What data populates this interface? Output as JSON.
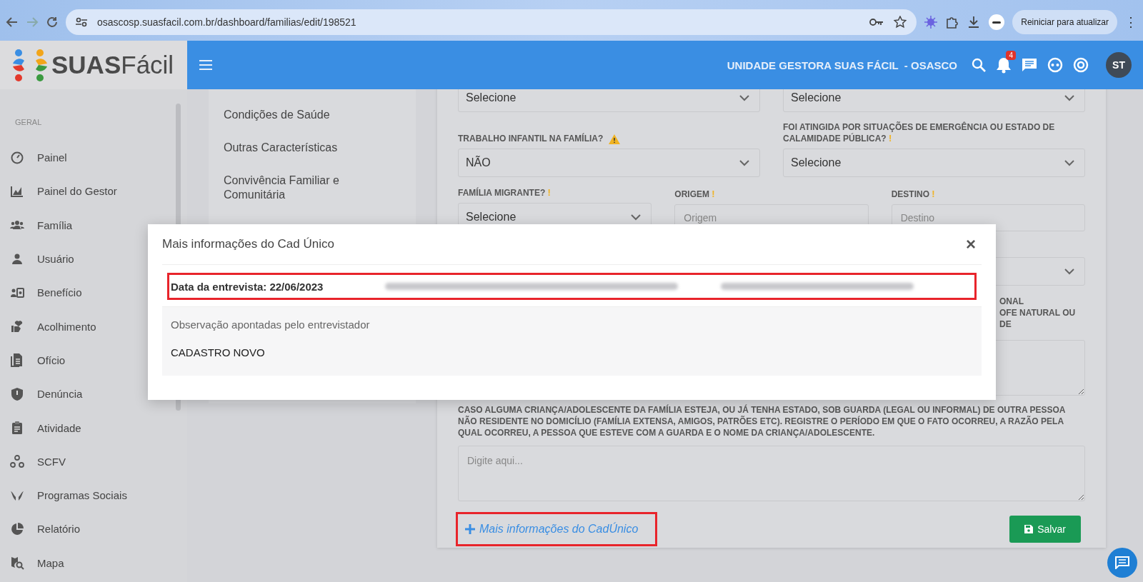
{
  "browser": {
    "url": "osascosp.suasfacil.com.br/dashboard/familias/edit/198521",
    "update_button": "Reiniciar para atualizar",
    "menu": "⋮"
  },
  "header": {
    "logo_bold": "SUAS",
    "logo_light": "Fácil",
    "unit": "UNIDADE GESTORA SUAS FÁCIL  - OSASCO",
    "notifications": "4",
    "avatar": "ST"
  },
  "sidebar": {
    "section": "GERAL",
    "items": [
      {
        "label": "Painel",
        "kind": "gauge"
      },
      {
        "label": "Painel do Gestor",
        "kind": "chart"
      },
      {
        "label": "Família",
        "kind": "group"
      },
      {
        "label": "Usuário",
        "kind": "person"
      },
      {
        "label": "Benefício",
        "kind": "card"
      },
      {
        "label": "Acolhimento",
        "kind": "heart"
      },
      {
        "label": "Ofício",
        "kind": "document"
      },
      {
        "label": "Denúncia",
        "kind": "shield"
      },
      {
        "label": "Atividade",
        "kind": "clipboard"
      },
      {
        "label": "SCFV",
        "kind": "nodes"
      },
      {
        "label": "Programas Sociais",
        "kind": "hands"
      },
      {
        "label": "Relatório",
        "kind": "pie"
      },
      {
        "label": "Mapa",
        "kind": "map"
      }
    ]
  },
  "form_nav": {
    "items": [
      {
        "label": "Condições de Saúde"
      },
      {
        "label": "Outras Características"
      },
      {
        "label": "Convivência Familiar e Comunitária"
      }
    ]
  },
  "form": {
    "rows": [
      [
        {
          "kind": "select",
          "value": "Selecione"
        },
        {
          "kind": "select",
          "value": "Selecione"
        }
      ],
      [
        {
          "kind": "select",
          "label": "TRABALHO INFANTIL NA FAMÍLIA?",
          "warning": true,
          "value": "NÃO"
        },
        {
          "kind": "select",
          "label": "FOI ATINGIDA POR SITUAÇÕES DE EMERGÊNCIA OU ESTADO DE CALAMIDADE PÚBLICA?",
          "mark": "!",
          "value": "Selecione"
        }
      ],
      [
        {
          "kind": "select",
          "label": "FAMÍLIA MIGRANTE?",
          "mark": "!",
          "value": "Selecione"
        },
        {
          "kind": "input",
          "label": "ORIGEM",
          "mark": "!",
          "placeholder": "Origem"
        },
        {
          "kind": "input",
          "label": "DESTINO",
          "mark": "!",
          "placeholder": "Destino"
        }
      ]
    ],
    "partial_label": [
      "ONAL",
      "OFE NATURAL OU DE"
    ],
    "note_label": "CASO ALGUMA CRIANÇA/ADOLESCENTE DA FAMÍLIA ESTEJA, OU JÁ TENHA ESTADO, SOB GUARDA (LEGAL OU INFORMAL) DE OUTRA PESSOA NÃO RESIDENTE NO DOMICÍLIO (FAMÍLIA EXTENSA, AMIGOS, PATRÕES ETC). REGISTRE O PERÍODO EM QUE O FATO OCORREU, A RAZÃO PELA QUAL OCORREU, A PESSOA QUE ESTEVE COM A GUARDA E O NOME DA CRIANÇA/ADOLESCENTE.",
    "note_placeholder": "Digite aqui...",
    "cad_link": {
      "label": "Mais informações do CadÚnico",
      "highlighted": true
    },
    "save_button": "Salvar"
  },
  "modal": {
    "title": "Mais informações do Cad Único",
    "close": "×",
    "interview_date": "Data da entrevista: 22/06/2023",
    "highlighted": true,
    "redacted_fields": [
      {
        "kind": "blur"
      },
      {
        "kind": "blur"
      }
    ],
    "observation_label": "Observação apontadas pelo entrevistador",
    "observation": "CADASTRO NOVO"
  }
}
